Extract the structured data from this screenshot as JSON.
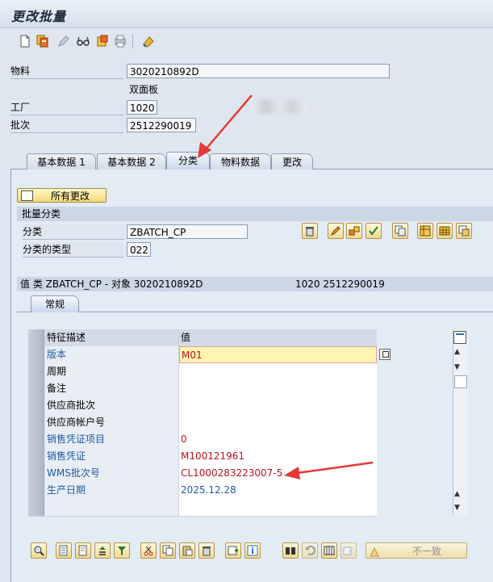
{
  "window": {
    "title": "更改批量"
  },
  "toolbar": {
    "icons": [
      "new-document-icon",
      "copy-document-icon",
      "pencil-icon",
      "glasses-icon",
      "folder-icon",
      "print-icon",
      "settings-icon"
    ]
  },
  "header": {
    "material_label": "物料",
    "material_value": "3020210892D",
    "material_desc": "双面板",
    "plant_label": "工厂",
    "plant_value": "1020",
    "batch_label": "批次",
    "batch_value": "2512290019"
  },
  "tabs": [
    "基本数据 1",
    "基本数据 2",
    "分类",
    "物料数据",
    "更改"
  ],
  "active_tab": "分类",
  "all_changes_button": "所有更改",
  "batch_class": {
    "title": "批量分类",
    "class_label": "分类",
    "class_value": "ZBATCH_CP",
    "class_type_label": "分类的类型",
    "class_type_value": "022"
  },
  "values_section": {
    "title": "值 类 ZBATCH_CP - 对象 3020210892D",
    "right_info": "1020 2512290019",
    "tab": "常规"
  },
  "grid": {
    "col_char": "特征描述",
    "col_value": "值",
    "rows": [
      {
        "label": "版本",
        "value": "M01",
        "label_color": "blue",
        "value_color": "red"
      },
      {
        "label": "周期",
        "value": "",
        "label_color": "black",
        "value_color": "black"
      },
      {
        "label": "备注",
        "value": "",
        "label_color": "black",
        "value_color": "black"
      },
      {
        "label": "供应商批次",
        "value": "",
        "label_color": "black",
        "value_color": "black"
      },
      {
        "label": "供应商帐户号",
        "value": "",
        "label_color": "black",
        "value_color": "black"
      },
      {
        "label": "销售凭证项目",
        "value": "0",
        "label_color": "blue",
        "value_color": "red"
      },
      {
        "label": "销售凭证",
        "value": "M100121961",
        "label_color": "blue",
        "value_color": "red"
      },
      {
        "label": "WMS批次号",
        "value": "CL1000283223007-5",
        "label_color": "blue",
        "value_color": "red"
      },
      {
        "label": "生产日期",
        "value": "2025.12.28",
        "label_color": "blue",
        "value_color": "blue"
      },
      {
        "label": "",
        "value": "",
        "label_color": "black",
        "value_color": "black"
      }
    ]
  },
  "bottom": {
    "inconsistent_button": "不一致"
  },
  "colors": {
    "annotation_arrow": "#e53935",
    "highlight_field": "#fff3b0"
  }
}
